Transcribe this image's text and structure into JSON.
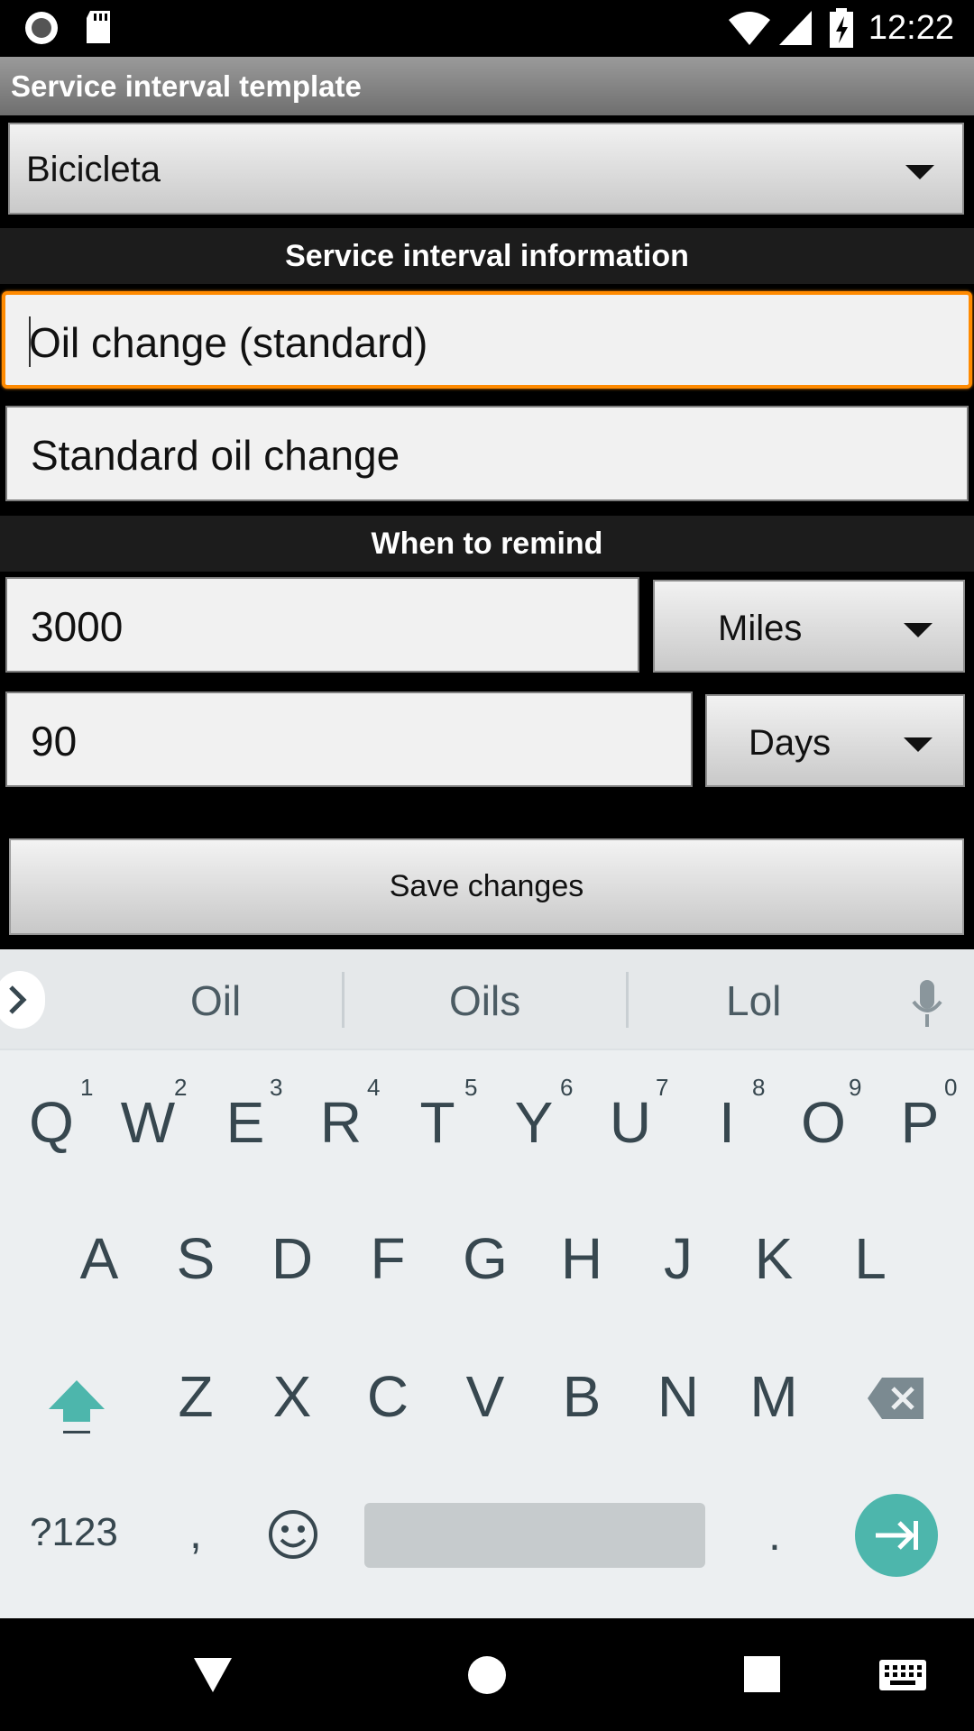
{
  "status_bar": {
    "time": "12:22",
    "left_icons": [
      "record-icon",
      "sd-card-icon"
    ],
    "right_icons": [
      "wifi-icon",
      "signal-icon",
      "battery-charging-icon"
    ]
  },
  "title_bar": {
    "title": "Service interval template"
  },
  "template_spinner": {
    "value": "Bicicleta"
  },
  "sections": {
    "info": "Service interval information",
    "remind": "When to remind"
  },
  "fields": {
    "name": {
      "value": "Oil change (standard)",
      "focused": true
    },
    "description": {
      "value": "Standard oil change"
    },
    "distance": {
      "value": "3000",
      "unit": "Miles"
    },
    "time": {
      "value": "90",
      "unit": "Days"
    }
  },
  "buttons": {
    "save": "Save changes"
  },
  "keyboard": {
    "suggestions": [
      "Oil",
      "Oils",
      "Lol"
    ],
    "row1": [
      {
        "key": "Q",
        "hint": "1"
      },
      {
        "key": "W",
        "hint": "2"
      },
      {
        "key": "E",
        "hint": "3"
      },
      {
        "key": "R",
        "hint": "4"
      },
      {
        "key": "T",
        "hint": "5"
      },
      {
        "key": "Y",
        "hint": "6"
      },
      {
        "key": "U",
        "hint": "7"
      },
      {
        "key": "I",
        "hint": "8"
      },
      {
        "key": "O",
        "hint": "9"
      },
      {
        "key": "P",
        "hint": "0"
      }
    ],
    "row2": [
      "A",
      "S",
      "D",
      "F",
      "G",
      "H",
      "J",
      "K",
      "L"
    ],
    "row3": [
      "Z",
      "X",
      "C",
      "V",
      "B",
      "N",
      "M"
    ],
    "symbols_key": "?123",
    "comma": ",",
    "period": ".",
    "accent_color": "#4db6ac"
  },
  "nav_bar": {
    "icons": [
      "back-icon",
      "home-icon",
      "recents-icon",
      "keyboard-icon"
    ]
  }
}
